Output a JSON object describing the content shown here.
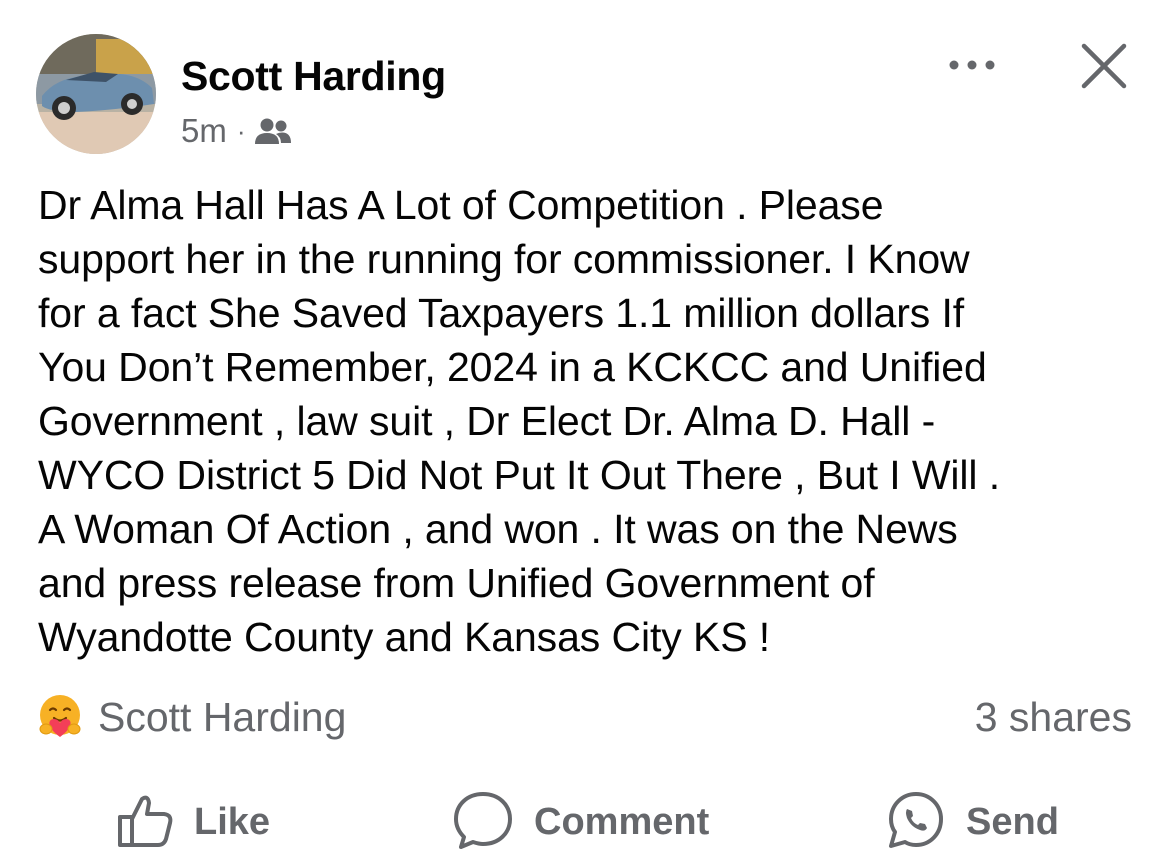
{
  "post": {
    "author": "Scott Harding",
    "time": "5m",
    "separator": "·",
    "audience_icon": "friends-icon",
    "text": "Dr Alma Hall Has A Lot of Competition . Please\nsupport her in the running for commissioner. I Know\nfor a fact She Saved Taxpayers 1.1 million dollars If\nYou Don’t Remember, 2024 in a KCKCC  and Unified\nGovernment  , law suit , Dr Elect Dr. Alma D. Hall -\nWYCO District 5 Did Not Put It Out There , But I Will .\nA Woman Of Action , and won . It was on the News\nand press release from Unified Government of\nWyandotte County and Kansas City KS  !"
  },
  "header_icons": {
    "more": "more-options-icon",
    "close": "close-icon"
  },
  "reactions": {
    "icon": "care-reaction-icon",
    "reactor": "Scott Harding",
    "shares": "3 shares"
  },
  "actions": {
    "like": "Like",
    "comment": "Comment",
    "send": "Send"
  },
  "colors": {
    "text": "#050505",
    "secondary": "#65676b",
    "reaction_yellow": "#f7b125",
    "reaction_red": "#f33e58"
  }
}
